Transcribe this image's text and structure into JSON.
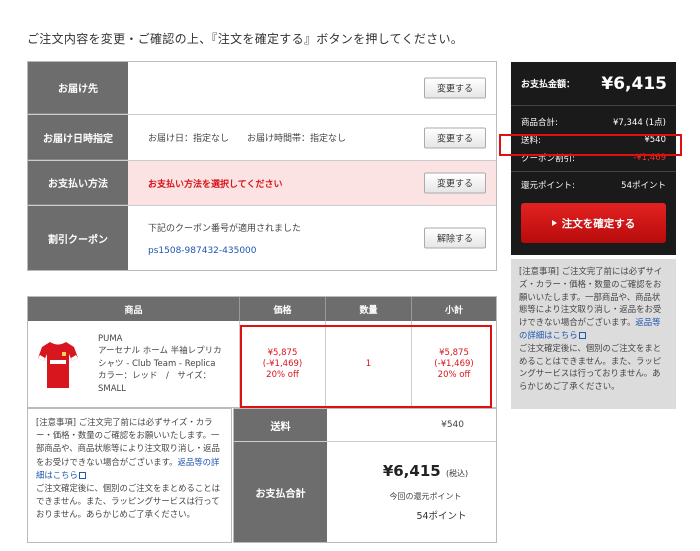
{
  "intro": "ご注文内容を変更・ご確認の上、『注文を確定する』ボタンを押してください。",
  "order": {
    "delivery_label": "お届け先",
    "datetime_label": "お届け日時指定",
    "datetime_value": "お届け日：指定なし　　お届け時間帯：指定なし",
    "payment_label": "お支払い方法",
    "payment_value": "お支払い方法を選択してください",
    "coupon_label": "割引クーポン",
    "coupon_note": "下記のクーポン番号が適用されました",
    "coupon_code": "ps1508-987432-435000",
    "change_label": "変更する",
    "cancel_label": "解除する"
  },
  "products": {
    "headers": [
      "商品",
      "価格",
      "数量",
      "小計"
    ],
    "item": {
      "brand": "PUMA",
      "name_line1": "アーセナル ホーム 半袖レプリカ",
      "name_line2": "シャツ - Club Team - Replica",
      "option_line": "カラー：レッド　/　サイズ：",
      "size": "SMALL",
      "price": "¥5,875",
      "discount": "(-¥1,469)",
      "off": "20% off",
      "quantity": "1",
      "subtotal": "¥5,875",
      "subtotal_discount": "(-¥1,469)",
      "subtotal_off": "20% off"
    }
  },
  "notice_bottom": {
    "text1": "[注意事項] ご注文完了前には必ずサイズ・カラー・価格・数量のご確認をお願いいたします。一部商品や、商品状態等により注文取り消し・返品をお受けできない場合がございます。",
    "link": "返品等の詳細はこちら",
    "text2": "ご注文確定後に、個別のご注文をまとめることはできません。また、ラッピングサービスは行っておりません。あらかじめご了承ください。"
  },
  "summary": {
    "shipping_label": "送料",
    "shipping_value": "¥540",
    "total_label": "お支払合計",
    "total_value": "¥6,415",
    "tax_label": "(税込)",
    "points_label": "今回の還元ポイント",
    "points_value": "54ポイント"
  },
  "side": {
    "pay_label": "お支払金額：",
    "pay_value": "¥6,415",
    "subtotal_label": "商品合計:",
    "subtotal_value": "¥7,344 (1点)",
    "shipping_label": "送料:",
    "shipping_value": "¥540",
    "coupon_label": "クーポン割引:",
    "coupon_value": "-¥1,469",
    "points_label": "還元ポイント:",
    "points_value": "54ポイント",
    "confirm_label": "注文を確定する",
    "notice_text1": "[注意事項] ご注文完了前には必ずサイズ・カラー・価格・数量のご確認をお願いいたします。一部商品や、商品状態等により注文取り消し・返品をお受けできない場合がございます。",
    "notice_link": "返品等の詳細はこちら",
    "notice_text2": "ご注文確定後に、個別のご注文をまとめることはできません。また、ラッピングサービスは行っておりません。あらかじめご了承ください。"
  },
  "colors": {
    "accent_red": "#d8141b",
    "header_gray": "#6d6d6d",
    "panel_dark": "#1a1a1a",
    "link_blue": "#1f56b3"
  }
}
